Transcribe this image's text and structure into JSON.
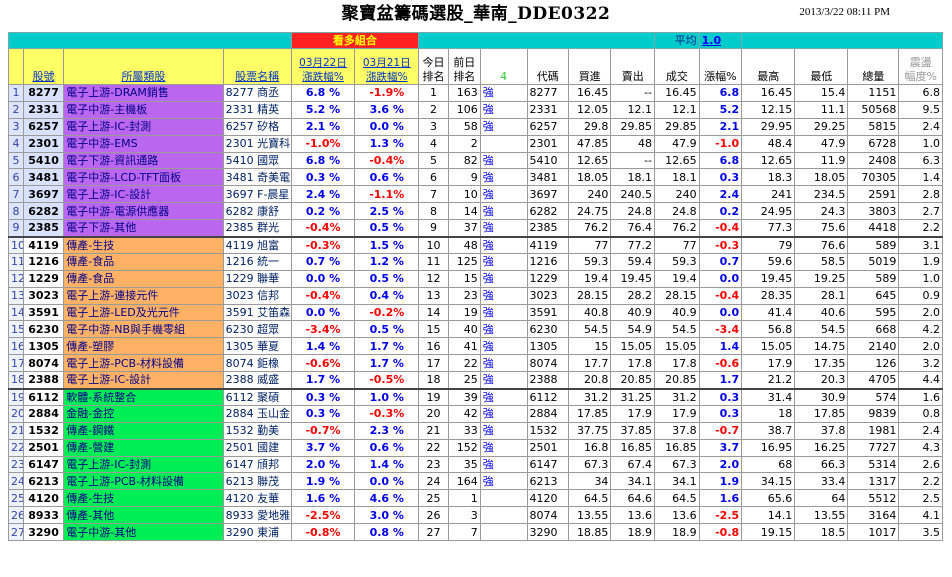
{
  "title": "聚寶盆籌碼選股_華南_DDE0322",
  "datetime": "2013/3/22  08:11 PM",
  "banner": {
    "label": "看多組合",
    "avg_label": "平均",
    "avg_value": "1.0"
  },
  "headers": {
    "code": "股號",
    "sector": "所屬類股",
    "name": "股票名稱",
    "d1_date": "03月22日",
    "d1_pct": "漲跌幅%",
    "d2_date": "03月21日",
    "d2_pct": "漲跌幅%",
    "rank_today_a": "今日",
    "rank_today_b": "排名",
    "rank_prev_a": "前日",
    "rank_prev_b": "排名",
    "signal": "4",
    "code2": "代碼",
    "bid": "買進",
    "ask": "賣出",
    "deal": "成交",
    "chg": "漲幅%",
    "high": "最高",
    "low": "最低",
    "vol": "總量",
    "amp_a": "震盪",
    "amp_b": "幅度%"
  },
  "rows": [
    {
      "i": "1",
      "code": "8277",
      "sector": "電子上游-DRAM銷售",
      "name": "8277 商丞",
      "d1": "6.8 %",
      "d2": "-1.9%",
      "rt": "1",
      "rp": "163",
      "sig": "強",
      "c2": "8277",
      "bid": "16.45",
      "ask": "--",
      "deal": "16.45",
      "chg": "6.8",
      "high": "16.45",
      "low": "15.4",
      "vol": "1151",
      "amp": "6.8"
    },
    {
      "i": "2",
      "code": "2331",
      "sector": "電子中游-主機板",
      "name": "2331 精英",
      "d1": "5.2 %",
      "d2": "3.6 %",
      "rt": "2",
      "rp": "106",
      "sig": "強",
      "c2": "2331",
      "bid": "12.05",
      "ask": "12.1",
      "deal": "12.1",
      "chg": "5.2",
      "high": "12.15",
      "low": "11.1",
      "vol": "50568",
      "amp": "9.5"
    },
    {
      "i": "3",
      "code": "6257",
      "sector": "電子上游-IC-封測",
      "name": "6257 矽格",
      "d1": "2.1 %",
      "d2": "0.0 %",
      "rt": "3",
      "rp": "58",
      "sig": "強",
      "c2": "6257",
      "bid": "29.8",
      "ask": "29.85",
      "deal": "29.85",
      "chg": "2.1",
      "high": "29.95",
      "low": "29.25",
      "vol": "5815",
      "amp": "2.4"
    },
    {
      "i": "4",
      "code": "2301",
      "sector": "電子中游-EMS",
      "name": "2301 光寶科",
      "d1": "-1.0%",
      "d2": "1.3 %",
      "rt": "4",
      "rp": "2",
      "sig": "",
      "c2": "2301",
      "bid": "47.85",
      "ask": "48",
      "deal": "47.9",
      "chg": "-1.0",
      "high": "48.4",
      "low": "47.9",
      "vol": "6728",
      "amp": "1.0"
    },
    {
      "i": "5",
      "code": "5410",
      "sector": "電子下游-資訊通路",
      "name": "5410 國眾",
      "d1": "6.8 %",
      "d2": "-0.4%",
      "rt": "5",
      "rp": "82",
      "sig": "強",
      "c2": "5410",
      "bid": "12.65",
      "ask": "--",
      "deal": "12.65",
      "chg": "6.8",
      "high": "12.65",
      "low": "11.9",
      "vol": "2408",
      "amp": "6.3"
    },
    {
      "i": "6",
      "code": "3481",
      "sector": "電子中游-LCD-TFT面板",
      "name": "3481 奇美電",
      "d1": "0.3 %",
      "d2": "0.6 %",
      "rt": "6",
      "rp": "9",
      "sig": "強",
      "c2": "3481",
      "bid": "18.05",
      "ask": "18.1",
      "deal": "18.1",
      "chg": "0.3",
      "high": "18.3",
      "low": "18.05",
      "vol": "70305",
      "amp": "1.4"
    },
    {
      "i": "7",
      "code": "3697",
      "sector": "電子上游-IC-設計",
      "name": "3697 F-晨星",
      "d1": "2.4 %",
      "d2": "-1.1%",
      "rt": "7",
      "rp": "10",
      "sig": "強",
      "c2": "3697",
      "bid": "240",
      "ask": "240.5",
      "deal": "240",
      "chg": "2.4",
      "high": "241",
      "low": "234.5",
      "vol": "2591",
      "amp": "2.8"
    },
    {
      "i": "8",
      "code": "6282",
      "sector": "電子中游-電源供應器",
      "name": "6282 康舒",
      "d1": "0.2 %",
      "d2": "2.5 %",
      "rt": "8",
      "rp": "14",
      "sig": "強",
      "c2": "6282",
      "bid": "24.75",
      "ask": "24.8",
      "deal": "24.8",
      "chg": "0.2",
      "high": "24.95",
      "low": "24.3",
      "vol": "3803",
      "amp": "2.7"
    },
    {
      "i": "9",
      "code": "2385",
      "sector": "電子下游-其他",
      "name": "2385 群光",
      "d1": "-0.4%",
      "d2": "0.5 %",
      "rt": "9",
      "rp": "37",
      "sig": "強",
      "c2": "2385",
      "bid": "76.2",
      "ask": "76.4",
      "deal": "76.2",
      "chg": "-0.4",
      "high": "77.3",
      "low": "75.6",
      "vol": "4418",
      "amp": "2.2"
    },
    {
      "i": "10",
      "code": "4119",
      "sector": "傳產-生技",
      "name": "4119 旭富",
      "d1": "-0.3%",
      "d2": "1.5 %",
      "rt": "10",
      "rp": "48",
      "sig": "強",
      "c2": "4119",
      "bid": "77",
      "ask": "77.2",
      "deal": "77",
      "chg": "-0.3",
      "high": "79",
      "low": "76.6",
      "vol": "589",
      "amp": "3.1"
    },
    {
      "i": "11",
      "code": "1216",
      "sector": "傳產-食品",
      "name": "1216 統一",
      "d1": "0.7 %",
      "d2": "1.2 %",
      "rt": "11",
      "rp": "125",
      "sig": "強",
      "c2": "1216",
      "bid": "59.3",
      "ask": "59.4",
      "deal": "59.3",
      "chg": "0.7",
      "high": "59.6",
      "low": "58.5",
      "vol": "5019",
      "amp": "1.9"
    },
    {
      "i": "12",
      "code": "1229",
      "sector": "傳產-食品",
      "name": "1229 聯華",
      "d1": "0.0 %",
      "d2": "0.5 %",
      "rt": "12",
      "rp": "15",
      "sig": "強",
      "c2": "1229",
      "bid": "19.4",
      "ask": "19.45",
      "deal": "19.4",
      "chg": "0.0",
      "high": "19.45",
      "low": "19.25",
      "vol": "589",
      "amp": "1.0"
    },
    {
      "i": "13",
      "code": "3023",
      "sector": "電子上游-連接元件",
      "name": "3023 信邦",
      "d1": "-0.4%",
      "d2": "0.4 %",
      "rt": "13",
      "rp": "23",
      "sig": "強",
      "c2": "3023",
      "bid": "28.15",
      "ask": "28.2",
      "deal": "28.15",
      "chg": "-0.4",
      "high": "28.35",
      "low": "28.1",
      "vol": "645",
      "amp": "0.9"
    },
    {
      "i": "14",
      "code": "3591",
      "sector": "電子上游-LED及光元件",
      "name": "3591 艾笛森",
      "d1": "0.0 %",
      "d2": "-0.2%",
      "rt": "14",
      "rp": "19",
      "sig": "強",
      "c2": "3591",
      "bid": "40.8",
      "ask": "40.9",
      "deal": "40.9",
      "chg": "0.0",
      "high": "41.4",
      "low": "40.6",
      "vol": "595",
      "amp": "2.0"
    },
    {
      "i": "15",
      "code": "6230",
      "sector": "電子中游-NB與手機零組",
      "name": "6230 超眾",
      "d1": "-3.4%",
      "d2": "0.5 %",
      "rt": "15",
      "rp": "40",
      "sig": "強",
      "c2": "6230",
      "bid": "54.5",
      "ask": "54.9",
      "deal": "54.5",
      "chg": "-3.4",
      "high": "56.8",
      "low": "54.5",
      "vol": "668",
      "amp": "4.2"
    },
    {
      "i": "16",
      "code": "1305",
      "sector": "傳產-塑膠",
      "name": "1305 華夏",
      "d1": "1.4 %",
      "d2": "1.7 %",
      "rt": "16",
      "rp": "41",
      "sig": "強",
      "c2": "1305",
      "bid": "15",
      "ask": "15.05",
      "deal": "15.05",
      "chg": "1.4",
      "high": "15.05",
      "low": "14.75",
      "vol": "2140",
      "amp": "2.0"
    },
    {
      "i": "17",
      "code": "8074",
      "sector": "電子上游-PCB-材料設備",
      "name": "8074 鉅橡",
      "d1": "-0.6%",
      "d2": "1.7 %",
      "rt": "17",
      "rp": "22",
      "sig": "強",
      "c2": "8074",
      "bid": "17.7",
      "ask": "17.8",
      "deal": "17.8",
      "chg": "-0.6",
      "high": "17.9",
      "low": "17.35",
      "vol": "126",
      "amp": "3.2"
    },
    {
      "i": "18",
      "code": "2388",
      "sector": "電子上游-IC-設計",
      "name": "2388 威盛",
      "d1": "1.7 %",
      "d2": "-0.5%",
      "rt": "18",
      "rp": "25",
      "sig": "強",
      "c2": "2388",
      "bid": "20.8",
      "ask": "20.85",
      "deal": "20.85",
      "chg": "1.7",
      "high": "21.2",
      "low": "20.3",
      "vol": "4705",
      "amp": "4.4"
    },
    {
      "i": "19",
      "code": "6112",
      "sector": "軟體-系統整合",
      "name": "6112 聚碩",
      "d1": "0.3 %",
      "d2": "1.0 %",
      "rt": "19",
      "rp": "39",
      "sig": "強",
      "c2": "6112",
      "bid": "31.2",
      "ask": "31.25",
      "deal": "31.2",
      "chg": "0.3",
      "high": "31.4",
      "low": "30.9",
      "vol": "574",
      "amp": "1.6"
    },
    {
      "i": "20",
      "code": "2884",
      "sector": "金融-金控",
      "name": "2884 玉山金",
      "d1": "0.3 %",
      "d2": "-0.3%",
      "rt": "20",
      "rp": "42",
      "sig": "強",
      "c2": "2884",
      "bid": "17.85",
      "ask": "17.9",
      "deal": "17.9",
      "chg": "0.3",
      "high": "18",
      "low": "17.85",
      "vol": "9839",
      "amp": "0.8"
    },
    {
      "i": "21",
      "code": "1532",
      "sector": "傳產-鋼鐵",
      "name": "1532 勤美",
      "d1": "-0.7%",
      "d2": "2.3 %",
      "rt": "21",
      "rp": "33",
      "sig": "強",
      "c2": "1532",
      "bid": "37.75",
      "ask": "37.85",
      "deal": "37.8",
      "chg": "-0.7",
      "high": "38.7",
      "low": "37.8",
      "vol": "1981",
      "amp": "2.4"
    },
    {
      "i": "22",
      "code": "2501",
      "sector": "傳產-營建",
      "name": "2501 國建",
      "d1": "3.7 %",
      "d2": "0.6 %",
      "rt": "22",
      "rp": "152",
      "sig": "強",
      "c2": "2501",
      "bid": "16.8",
      "ask": "16.85",
      "deal": "16.85",
      "chg": "3.7",
      "high": "16.95",
      "low": "16.25",
      "vol": "7727",
      "amp": "4.3"
    },
    {
      "i": "23",
      "code": "6147",
      "sector": "電子上游-IC-封測",
      "name": "6147 頎邦",
      "d1": "2.0 %",
      "d2": "1.4 %",
      "rt": "23",
      "rp": "35",
      "sig": "強",
      "c2": "6147",
      "bid": "67.3",
      "ask": "67.4",
      "deal": "67.3",
      "chg": "2.0",
      "high": "68",
      "low": "66.3",
      "vol": "5314",
      "amp": "2.6"
    },
    {
      "i": "24",
      "code": "6213",
      "sector": "電子上游-PCB-材料設備",
      "name": "6213 聯茂",
      "d1": "1.9 %",
      "d2": "0.0 %",
      "rt": "24",
      "rp": "164",
      "sig": "強",
      "c2": "6213",
      "bid": "34",
      "ask": "34.1",
      "deal": "34.1",
      "chg": "1.9",
      "high": "34.15",
      "low": "33.4",
      "vol": "1317",
      "amp": "2.2"
    },
    {
      "i": "25",
      "code": "4120",
      "sector": "傳產-生技",
      "name": "4120 友華",
      "d1": "1.6 %",
      "d2": "4.6 %",
      "rt": "25",
      "rp": "1",
      "sig": "",
      "c2": "4120",
      "bid": "64.5",
      "ask": "64.6",
      "deal": "64.5",
      "chg": "1.6",
      "high": "65.6",
      "low": "64",
      "vol": "5512",
      "amp": "2.5"
    },
    {
      "i": "26",
      "code": "8933",
      "sector": "傳產-其他",
      "name": "8933 愛地雅",
      "d1": "-2.5%",
      "d2": "3.0 %",
      "rt": "26",
      "rp": "3",
      "sig": "",
      "c2": "8074",
      "bid": "13.55",
      "ask": "13.6",
      "deal": "13.6",
      "chg": "-2.5",
      "high": "14.1",
      "low": "13.55",
      "vol": "3164",
      "amp": "4.1"
    },
    {
      "i": "27",
      "code": "3290",
      "sector": "電子中游-其他",
      "name": "3290 東浦",
      "d1": "-0.8%",
      "d2": "0.8 %",
      "rt": "27",
      "rp": "7",
      "sig": "",
      "c2": "3290",
      "bid": "18.85",
      "ask": "18.9",
      "deal": "18.9",
      "chg": "-0.8",
      "high": "19.15",
      "low": "18.5",
      "vol": "1017",
      "amp": "3.5"
    }
  ]
}
